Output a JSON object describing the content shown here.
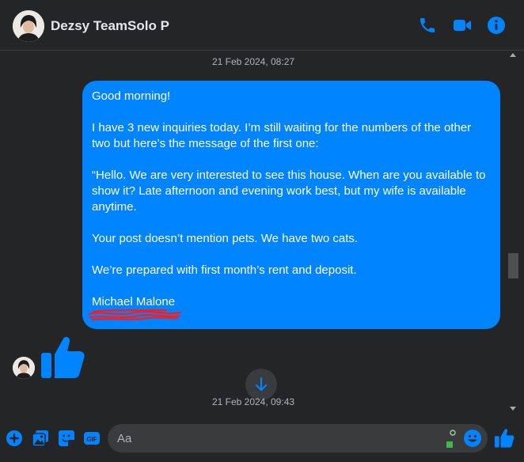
{
  "header": {
    "contact_name": "Dezsy TeamSolo P",
    "icons": [
      "phone-icon",
      "video-camera-icon",
      "info-icon"
    ]
  },
  "thread": {
    "timestamp_top": "21 Feb 2024, 08:27",
    "timestamp_bottom": "21 Feb 2024, 09:43",
    "message": {
      "paragraphs": [
        "Good morning!",
        "I have 3 new inquiries today. I’m still waiting for the numbers of the other two but here’s the message of the first one:",
        "“Hello. We are very interested to see this house. When are you available to show it? Late afternoon and evening work best, but my wife is available anytime.",
        "Your post doesn’t mention pets. We have two cats.",
        "We’re prepared with first month’s rent and deposit.",
        "Michael Malone"
      ],
      "redaction_color": "#ff0000"
    },
    "reply_icon": "thumbs-up-icon"
  },
  "composer": {
    "placeholder": "Aa",
    "icons": [
      "plus-circle-icon",
      "image-icon",
      "sticker-icon",
      "gif-icon",
      "emoji-icon",
      "thumbs-up-icon"
    ]
  },
  "colors": {
    "accent": "#0084ff",
    "background": "#242526",
    "input_background": "#3a3b3c"
  }
}
